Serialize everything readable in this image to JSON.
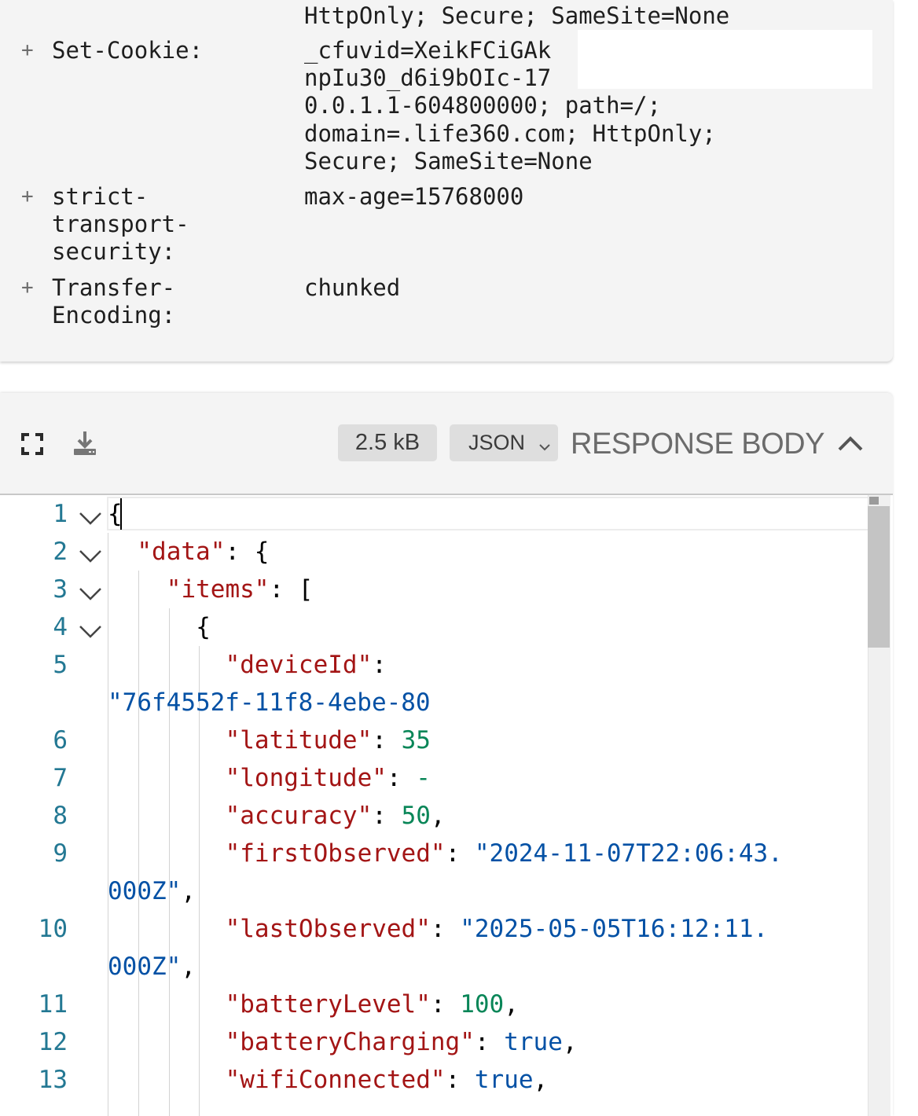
{
  "headers": {
    "partial_line": "HttpOnly; Secure; SameSite=None",
    "rows": [
      {
        "name_lines": [
          "Set-Cookie:"
        ],
        "value_lines": [
          "_cfuvid=XeikFCiGAk",
          "npIu30_d6i9bOIc-17",
          "0.0.1.1-604800000; path=/;",
          "domain=.life360.com; HttpOnly;",
          "Secure; SameSite=None"
        ],
        "expand_symbol": "+"
      },
      {
        "name_lines": [
          "strict-",
          "transport-",
          "security:"
        ],
        "value_lines": [
          "max-age=15768000"
        ],
        "expand_symbol": "+"
      },
      {
        "name_lines": [
          "Transfer-",
          "Encoding:"
        ],
        "value_lines": [
          "chunked"
        ],
        "expand_symbol": "+"
      }
    ]
  },
  "response": {
    "size": "2.5 kB",
    "format": "JSON",
    "title": "RESPONSE BODY",
    "icons": [
      "fullscreen-icon",
      "download-icon",
      "chevron-down-icon",
      "chevron-up-icon"
    ]
  },
  "editor": {
    "lines": [
      {
        "num": "1",
        "foldable": true,
        "tokens": [
          {
            "t": "p",
            "v": "{"
          }
        ]
      },
      {
        "num": "2",
        "foldable": true,
        "tokens": [
          {
            "t": "k",
            "v": "\"data\""
          },
          {
            "t": "p",
            "v": ": {"
          }
        ]
      },
      {
        "num": "3",
        "foldable": true,
        "tokens": [
          {
            "t": "k",
            "v": "\"items\""
          },
          {
            "t": "p",
            "v": ": ["
          }
        ]
      },
      {
        "num": "4",
        "foldable": true,
        "tokens": [
          {
            "t": "p",
            "v": "{"
          }
        ]
      },
      {
        "num": "5",
        "foldable": false,
        "tokens": [
          {
            "t": "k",
            "v": "\"deviceId\""
          },
          {
            "t": "p",
            "v": ":"
          }
        ],
        "wrap": [
          {
            "t": "s",
            "v": "\"76f4552f-11f8-4ebe-80"
          }
        ]
      },
      {
        "num": "6",
        "foldable": false,
        "tokens": [
          {
            "t": "k",
            "v": "\"latitude\""
          },
          {
            "t": "p",
            "v": ": "
          },
          {
            "t": "n",
            "v": "35"
          }
        ]
      },
      {
        "num": "7",
        "foldable": false,
        "tokens": [
          {
            "t": "k",
            "v": "\"longitude\""
          },
          {
            "t": "p",
            "v": ": "
          },
          {
            "t": "n",
            "v": "-"
          }
        ]
      },
      {
        "num": "8",
        "foldable": false,
        "tokens": [
          {
            "t": "k",
            "v": "\"accuracy\""
          },
          {
            "t": "p",
            "v": ": "
          },
          {
            "t": "n",
            "v": "50"
          },
          {
            "t": "p",
            "v": ","
          }
        ]
      },
      {
        "num": "9",
        "foldable": false,
        "tokens": [
          {
            "t": "k",
            "v": "\"firstObserved\""
          },
          {
            "t": "p",
            "v": ": "
          },
          {
            "t": "s",
            "v": "\"2024-11-07T22:06:43."
          }
        ],
        "wrap": [
          {
            "t": "s",
            "v": "000Z\""
          },
          {
            "t": "p",
            "v": ","
          }
        ]
      },
      {
        "num": "10",
        "foldable": false,
        "tokens": [
          {
            "t": "k",
            "v": "\"lastObserved\""
          },
          {
            "t": "p",
            "v": ": "
          },
          {
            "t": "s",
            "v": "\"2025-05-05T16:12:11."
          }
        ],
        "wrap": [
          {
            "t": "s",
            "v": "000Z\""
          },
          {
            "t": "p",
            "v": ","
          }
        ]
      },
      {
        "num": "11",
        "foldable": false,
        "tokens": [
          {
            "t": "k",
            "v": "\"batteryLevel\""
          },
          {
            "t": "p",
            "v": ": "
          },
          {
            "t": "n",
            "v": "100"
          },
          {
            "t": "p",
            "v": ","
          }
        ]
      },
      {
        "num": "12",
        "foldable": false,
        "tokens": [
          {
            "t": "k",
            "v": "\"batteryCharging\""
          },
          {
            "t": "p",
            "v": ": "
          },
          {
            "t": "b",
            "v": "true"
          },
          {
            "t": "p",
            "v": ","
          }
        ]
      },
      {
        "num": "13",
        "foldable": false,
        "tokens": [
          {
            "t": "k",
            "v": "\"wifiConnected\""
          },
          {
            "t": "p",
            "v": ": "
          },
          {
            "t": "b",
            "v": "true"
          },
          {
            "t": "p",
            "v": ","
          }
        ]
      }
    ]
  },
  "colors": {
    "line_number": "#237893",
    "json_key": "#a31515",
    "json_string": "#0451a5",
    "json_number": "#098658",
    "json_boolean": "#0451a5"
  }
}
